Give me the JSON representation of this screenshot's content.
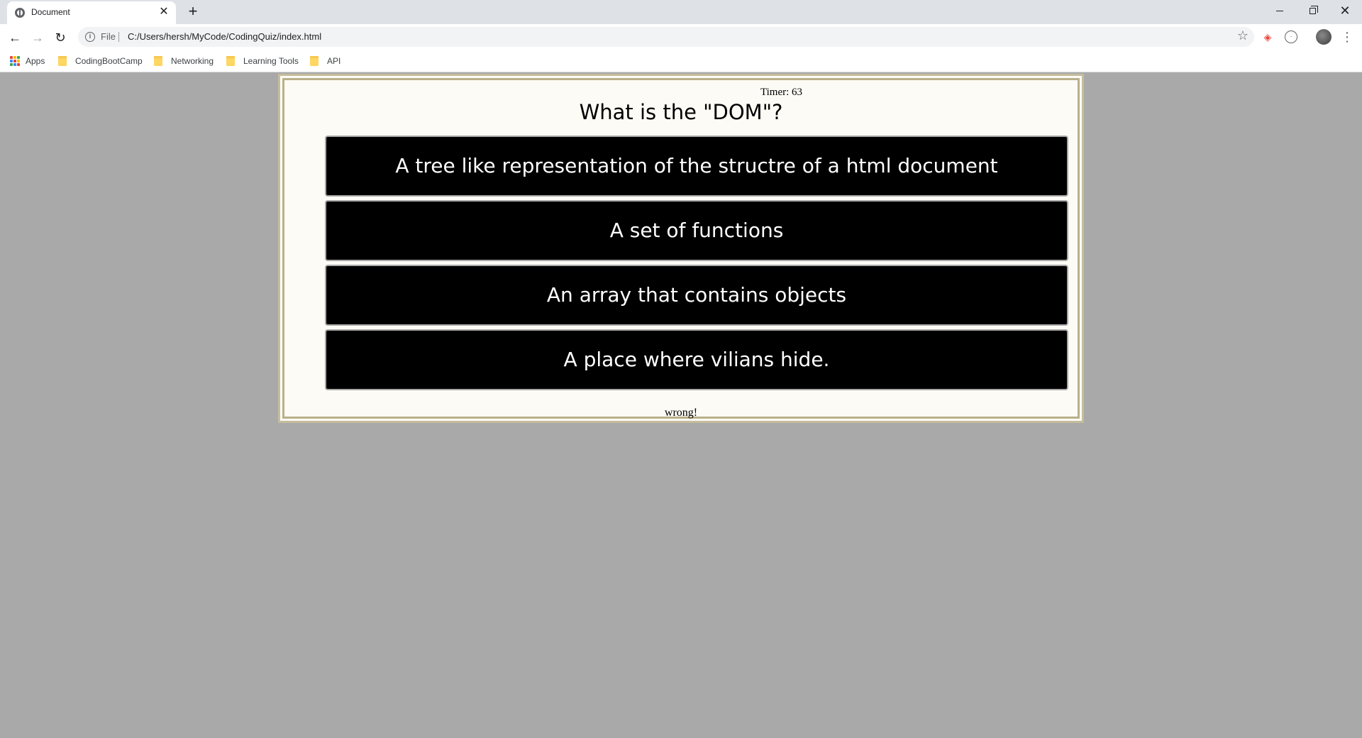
{
  "browser": {
    "tab_title": "Document",
    "tab_close": "✕",
    "new_tab": "+",
    "url_scheme": "File",
    "url": "C:/Users/hersh/MyCode/CodingQuiz/index.html",
    "bookmarks": [
      "Apps",
      "CodingBootCamp",
      "Networking",
      "Learning Tools",
      "API"
    ],
    "icons": {
      "back": "arrow-left-icon",
      "forward": "arrow-right-icon",
      "reload": "reload-icon",
      "info": "info-icon",
      "star": "star-icon",
      "menu": "kebab-menu-icon"
    }
  },
  "quiz": {
    "timer": "Timer: 63",
    "question": "What is the \"DOM\"?",
    "answers": [
      "A tree like representation of the structre of a html document",
      "A set of functions",
      "An array that contains objects",
      "A place where vilians hide."
    ],
    "feedback": "wrong!"
  },
  "colors": {
    "page_background": "#a9a9a9",
    "quiz_background": "#fdfbf5",
    "quiz_border": "#b9b08a",
    "answer_background": "#000000",
    "answer_text": "#ffffff"
  }
}
